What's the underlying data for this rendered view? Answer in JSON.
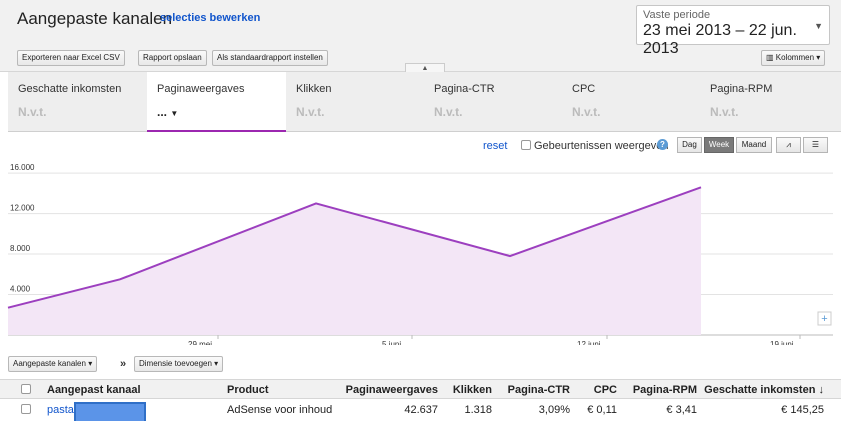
{
  "header": {
    "title": "Aangepaste kanalen",
    "edit_link": "selecties bewerken",
    "period_label": "Vaste periode",
    "period_range": "23 mei 2013 – 22 jun. 2013"
  },
  "toolbar": {
    "export_label": "Exporteren naar Excel CSV",
    "save_report_label": "Rapport opslaan",
    "default_report_label": "Als standaardrapport instellen",
    "columns_label": "Kolommen"
  },
  "metrics": [
    {
      "label": "Geschatte inkomsten",
      "value": "N.v.t."
    },
    {
      "label": "Paginaweergaves",
      "value": "..."
    },
    {
      "label": "Klikken",
      "value": "N.v.t."
    },
    {
      "label": "Pagina-CTR",
      "value": "N.v.t."
    },
    {
      "label": "CPC",
      "value": "N.v.t."
    },
    {
      "label": "Pagina-RPM",
      "value": "N.v.t."
    }
  ],
  "chart_controls": {
    "reset_label": "reset",
    "events_label": "Gebeurtenissen weergeven",
    "granularity": [
      "Dag",
      "Week",
      "Maand"
    ],
    "selected_granularity": "Week"
  },
  "chart_data": {
    "type": "area",
    "x": [
      "23 mei",
      "29 mei",
      "5 juni",
      "12 juni",
      "19 juni"
    ],
    "series": [
      {
        "values": [
          2700,
          5500,
          13000,
          7800,
          14600
        ]
      }
    ],
    "yticks": [
      "4.000",
      "8.000",
      "12.000",
      "16.000"
    ],
    "xtick_labels": [
      "29 mei",
      "5 juni",
      "12 juni",
      "19 juni"
    ],
    "ylim": [
      0,
      17000
    ],
    "color": "#9c3fbf"
  },
  "dimensions": {
    "primary_label": "Aangepaste kanalen",
    "add_dimension_label": "Dimensie toevoegen"
  },
  "table": {
    "headers": [
      "Aangepast kanaal",
      "Product",
      "Paginaweergaves",
      "Klikken",
      "Pagina-CTR",
      "CPC",
      "Pagina-RPM",
      "Geschatte inkomsten ↓"
    ],
    "rows": [
      {
        "channel": "pasta",
        "product": "AdSense voor inhoud",
        "pageviews": "42.637",
        "clicks": "1.318",
        "ctr": "3,09%",
        "cpc": "€ 0,11",
        "rpm": "€ 3,41",
        "revenue": "€ 145,25"
      }
    ]
  }
}
